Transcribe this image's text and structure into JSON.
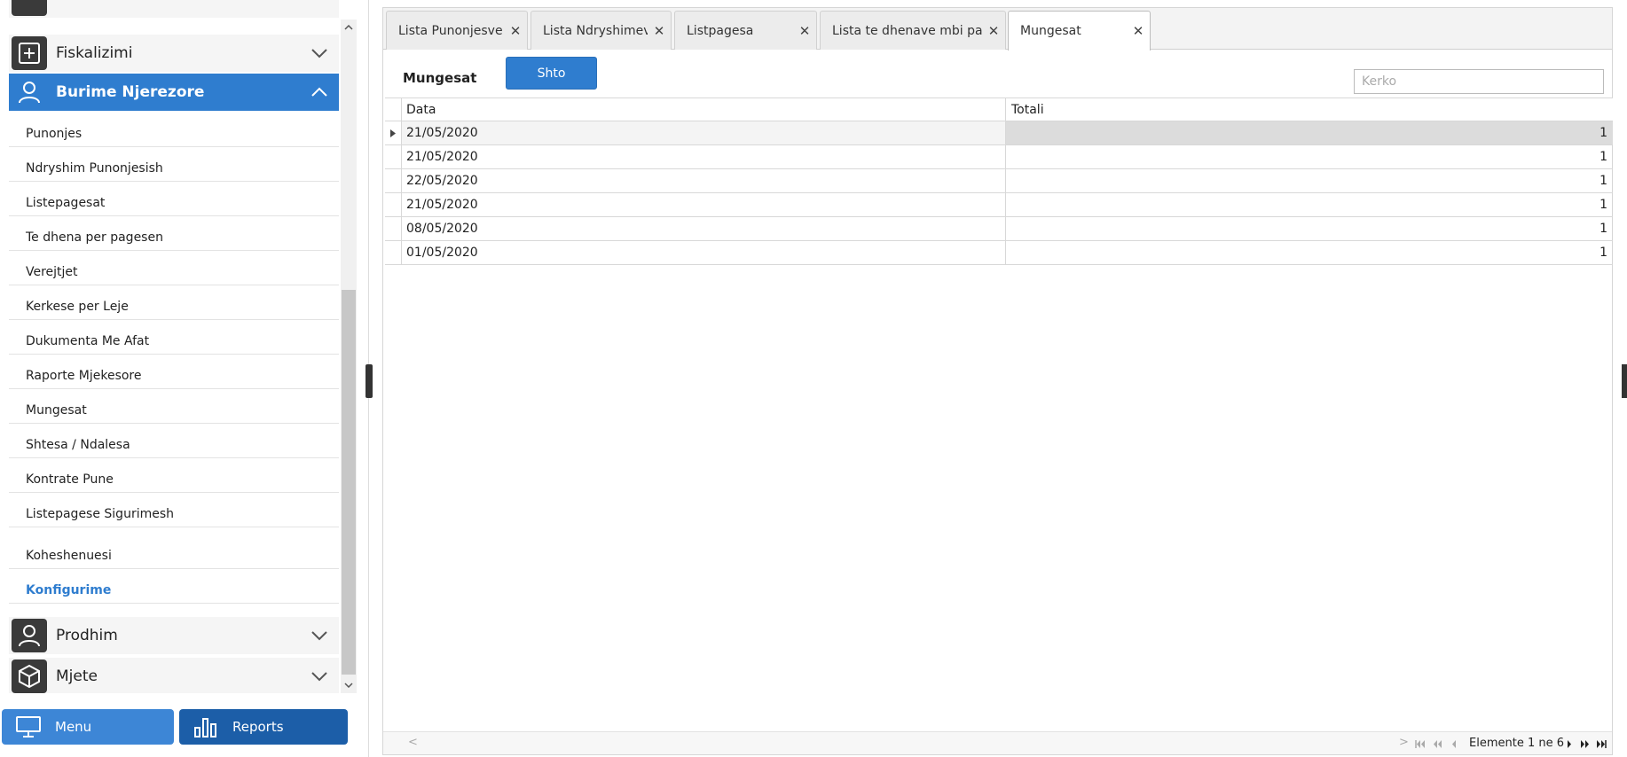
{
  "sidebar": {
    "groups": {
      "fiskalizimi": {
        "label": "Fiskalizimi",
        "icon": "plus-square-icon"
      },
      "burime": {
        "label": "Burime Njerezore",
        "icon": "person-icon"
      },
      "prodhim": {
        "label": "Prodhim",
        "icon": "person-icon"
      },
      "mjete": {
        "label": "Mjete",
        "icon": "cube-icon"
      }
    },
    "items": [
      {
        "label": "Punonjes"
      },
      {
        "label": "Ndryshim Punonjesish"
      },
      {
        "label": "Listepagesat"
      },
      {
        "label": "Te dhena per pagesen"
      },
      {
        "label": "Verejtjet"
      },
      {
        "label": "Kerkese per Leje"
      },
      {
        "label": "Dukumenta Me Afat"
      },
      {
        "label": "Raporte Mjekesore"
      },
      {
        "label": "Mungesat"
      },
      {
        "label": "Shtesa / Ndalesa"
      },
      {
        "label": "Kontrate Pune"
      },
      {
        "label": "Listepagese Sigurimesh"
      },
      {
        "label": "Koheshenuesi"
      },
      {
        "label": "Konfigurime"
      }
    ],
    "selected_item": "Konfigurime",
    "bottom_tabs": {
      "menu": "Menu",
      "reports": "Reports"
    }
  },
  "tabs": [
    {
      "label": "Lista Punonjesve"
    },
    {
      "label": "Lista Ndryshimeve"
    },
    {
      "label": "Listpagesa"
    },
    {
      "label": "Lista te dhenave mbi pagesen"
    },
    {
      "label": "Mungesat"
    }
  ],
  "active_tab": "Mungesat",
  "toolbar": {
    "title": "Mungesat",
    "add_label": "Shto",
    "search_placeholder": "Kerko"
  },
  "grid": {
    "columns": {
      "date": "Data",
      "total": "Totali"
    },
    "rows": [
      {
        "date": "21/05/2020",
        "total": "1"
      },
      {
        "date": "21/05/2020",
        "total": "1"
      },
      {
        "date": "22/05/2020",
        "total": "1"
      },
      {
        "date": "21/05/2020",
        "total": "1"
      },
      {
        "date": "08/05/2020",
        "total": "1"
      },
      {
        "date": "01/05/2020",
        "total": "1"
      }
    ]
  },
  "pager": {
    "info": "Elemente 1 ne 6"
  },
  "colors": {
    "accent": "#2f7dcf",
    "reports_tab": "#1c5ea8",
    "menu_tab": "#3d86d6"
  }
}
